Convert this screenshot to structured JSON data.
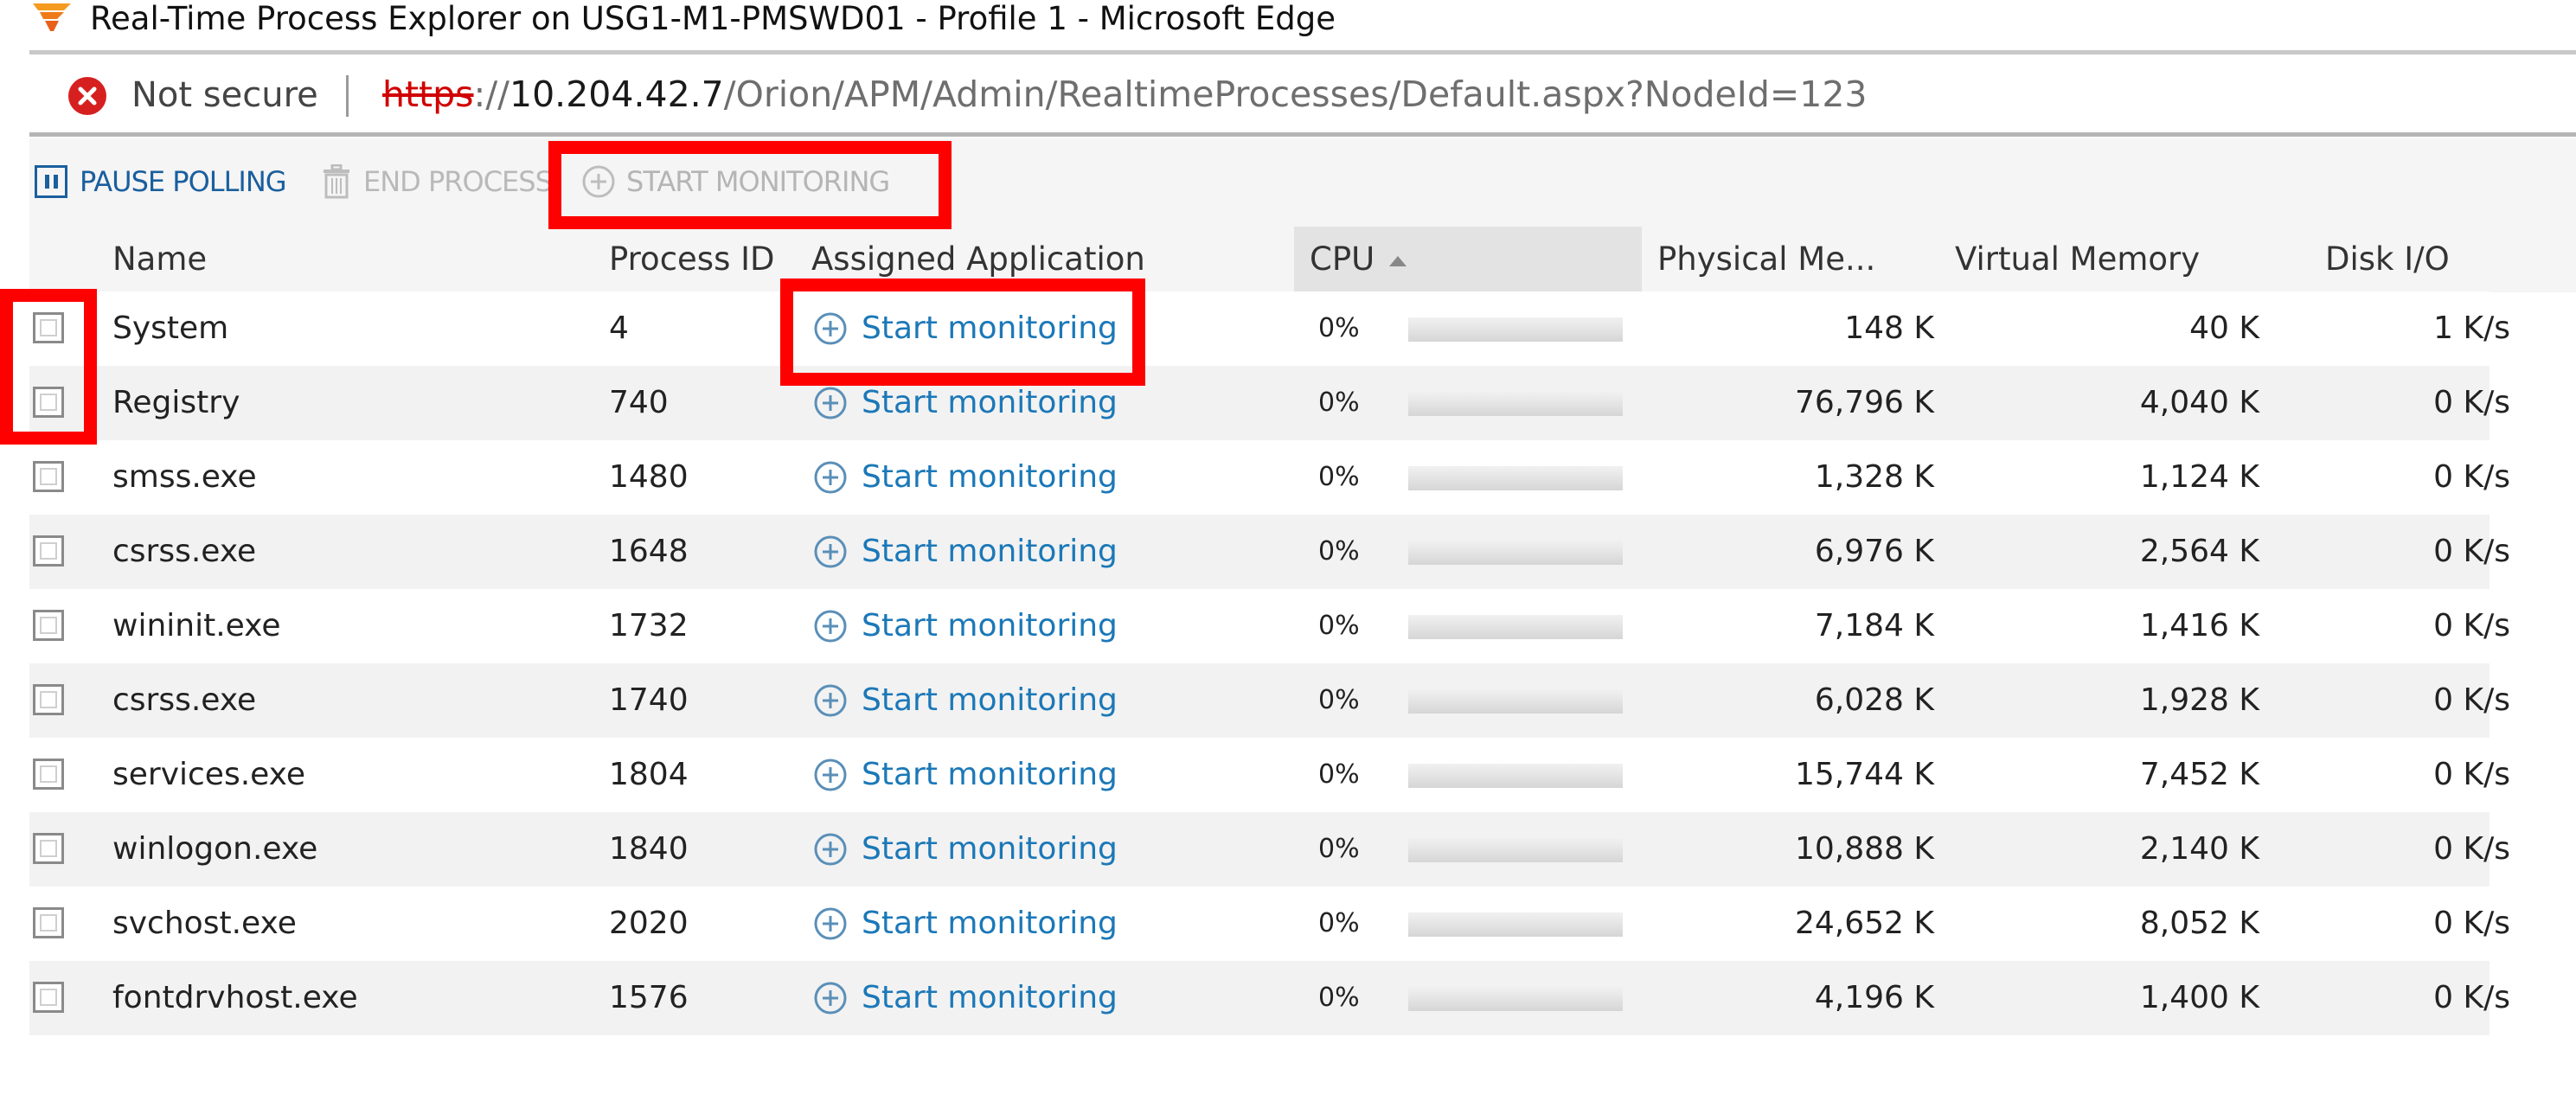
{
  "window": {
    "title": "Real-Time Process Explorer on USG1-M1-PMSWD01 - Profile 1 - Microsoft Edge",
    "logo_icon": "solarwinds-flame-icon"
  },
  "address_bar": {
    "security_icon": "error-x-circle-icon",
    "security_label": "Not secure",
    "url_scheme": "https",
    "url_sep": "://",
    "url_host": "10.204.42.7",
    "url_path": "/Orion/APM/Admin/RealtimeProcesses/Default.aspx?NodeId=123"
  },
  "toolbar": {
    "pause_label": "PAUSE POLLING",
    "end_label": "END PROCESS",
    "start_label": "START MONITORING"
  },
  "table": {
    "columns": {
      "name": "Name",
      "pid": "Process ID",
      "app": "Assigned Application",
      "cpu": "CPU",
      "phys": "Physical Me...",
      "virt": "Virtual Memory",
      "disk": "Disk I/O"
    },
    "sort": {
      "column": "CPU",
      "direction": "ascending"
    },
    "rows": [
      {
        "name": "System",
        "pid": "4",
        "app": "Start monitoring",
        "cpu": "0%",
        "cpu_fraction": 0,
        "phys": "148 K",
        "virt": "40 K",
        "disk": "1 K/s"
      },
      {
        "name": "Registry",
        "pid": "740",
        "app": "Start monitoring",
        "cpu": "0%",
        "cpu_fraction": 0,
        "phys": "76,796 K",
        "virt": "4,040 K",
        "disk": "0 K/s"
      },
      {
        "name": "smss.exe",
        "pid": "1480",
        "app": "Start monitoring",
        "cpu": "0%",
        "cpu_fraction": 0,
        "phys": "1,328 K",
        "virt": "1,124 K",
        "disk": "0 K/s"
      },
      {
        "name": "csrss.exe",
        "pid": "1648",
        "app": "Start monitoring",
        "cpu": "0%",
        "cpu_fraction": 0,
        "phys": "6,976 K",
        "virt": "2,564 K",
        "disk": "0 K/s"
      },
      {
        "name": "wininit.exe",
        "pid": "1732",
        "app": "Start monitoring",
        "cpu": "0%",
        "cpu_fraction": 0,
        "phys": "7,184 K",
        "virt": "1,416 K",
        "disk": "0 K/s"
      },
      {
        "name": "csrss.exe",
        "pid": "1740",
        "app": "Start monitoring",
        "cpu": "0%",
        "cpu_fraction": 0,
        "phys": "6,028 K",
        "virt": "1,928 K",
        "disk": "0 K/s"
      },
      {
        "name": "services.exe",
        "pid": "1804",
        "app": "Start monitoring",
        "cpu": "0%",
        "cpu_fraction": 0,
        "phys": "15,744 K",
        "virt": "7,452 K",
        "disk": "0 K/s"
      },
      {
        "name": "winlogon.exe",
        "pid": "1840",
        "app": "Start monitoring",
        "cpu": "0%",
        "cpu_fraction": 0,
        "phys": "10,888 K",
        "virt": "2,140 K",
        "disk": "0 K/s"
      },
      {
        "name": "svchost.exe",
        "pid": "2020",
        "app": "Start monitoring",
        "cpu": "0%",
        "cpu_fraction": 0,
        "phys": "24,652 K",
        "virt": "8,052 K",
        "disk": "0 K/s"
      },
      {
        "name": "fontdrvhost.exe",
        "pid": "1576",
        "app": "Start monitoring",
        "cpu": "0%",
        "cpu_fraction": 0,
        "phys": "4,196 K",
        "virt": "1,400 K",
        "disk": "0 K/s"
      }
    ]
  },
  "colors": {
    "highlight": "#ff0000",
    "link": "#1b78b8",
    "toolbar_active": "#1a5f9e",
    "disabled": "#b5b5b5"
  }
}
